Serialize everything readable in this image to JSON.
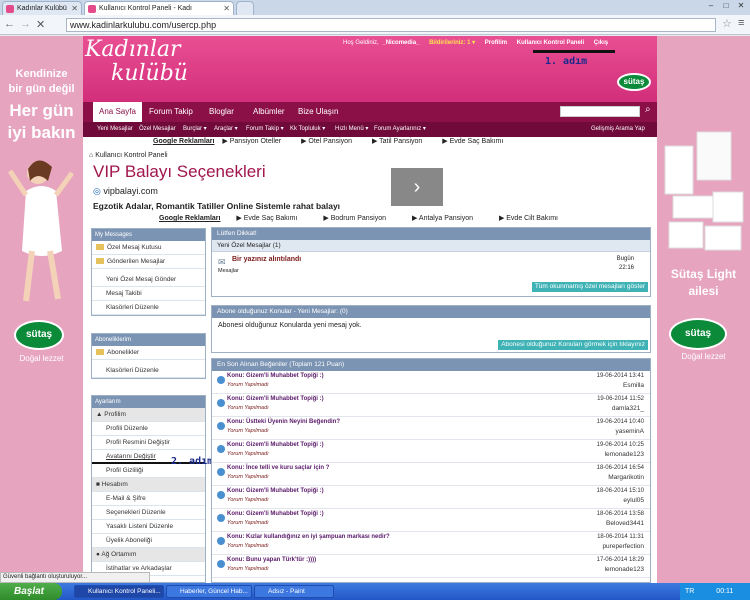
{
  "browser": {
    "tabs": [
      {
        "label": "Kadınlar Kulübü"
      },
      {
        "label": "Kullanıcı Kontrol Paneli - Kadı"
      }
    ],
    "url": "www.kadinlarkulubu.com/usercp.php"
  },
  "header": {
    "logo_line1": "Kadınlar",
    "logo_line2": "kulübü",
    "greeting": "Hoş Geldiniz,",
    "username": "_Nicomedia_",
    "notifications": "Bildirileriniz: 1 ▾",
    "profile_link": "Profilim",
    "cp_link": "Kullanıcı Kontrol Paneli",
    "logout": "Çıkış",
    "brand_badge": "sütaş",
    "annotation1": "1. adım"
  },
  "nav": {
    "items": [
      "Ana Sayfa",
      "Forum Takip",
      "Bloglar",
      "Albümler",
      "Bize Ulaşın"
    ],
    "search_placeholder": ""
  },
  "subnav": {
    "items": [
      "Yeni Mesajlar",
      "Özel Mesajlar",
      "Burçlar ▾",
      "Araçlar ▾",
      "Forum Takip ▾",
      "Kk Topluluk ▾",
      "Hızlı Menü ▾",
      "Forum Ayarlarınız ▾"
    ],
    "advanced_search": "Gelişmiş Arama Yap"
  },
  "google_ads_1": {
    "label": "Google Reklamları",
    "links": [
      "▶ Pansiyon Oteller",
      "▶ Otel Pansiyon",
      "▶ Tatil Pansiyon",
      "▶ Evde Saç Bakımı"
    ]
  },
  "breadcrumb": "Kullanıcı Kontrol Paneli",
  "vip_ad": {
    "title": "VIP Balayı Seçenekleri",
    "url": "vipbalayi.com",
    "desc": "Egzotik Adalar, Romantik Tatiller Online Sistemle rahat balayı",
    "arrow": "›"
  },
  "google_ads_2": {
    "label": "Google Reklamları",
    "links": [
      "▶ Evde Saç Bakımı",
      "▶ Bodrum Pansiyon",
      "▶ Antalya Pansiyon",
      "▶ Evde Cilt Bakımı"
    ]
  },
  "sidebar": {
    "my_messages": {
      "title": "My Messages",
      "items": [
        "Özel Mesaj Kutusu",
        "Gönderilen Mesajlar",
        "Yeni Özel Mesaj Gönder",
        "Mesaj Takibi",
        "Klasörleri Düzenle"
      ]
    },
    "subscriptions": {
      "title": "Aboneliklerim",
      "items": [
        "Abonelikler",
        "Klasörleri Düzenle"
      ]
    },
    "settings": {
      "title": "Ayarlarım",
      "profile_header": "Profilim",
      "profile_items": [
        "Profili Düzenle",
        "Profil Resmini Değiştir",
        "Avatarını Değiştir",
        "Profil Gizliliği"
      ],
      "account_header": "Hesabım",
      "account_items": [
        "E-Mail & Şifre",
        "Seçenekleri Düzenle",
        "Yasaklı Listeni Düzenle",
        "Üyelik Aboneliği"
      ],
      "network_header": "Ağ Ortamım",
      "network_items": [
        "İstihatlar ve Arkadaşlar"
      ]
    },
    "annotation2": "2. adım"
  },
  "attention_panel": {
    "title": "Lütfen Dikkat!",
    "sub": "Yeni Özel Mesajlar (1)",
    "msg_title": "Bir yazınız alıntılandı",
    "msg_from": "Mesajlar",
    "msg_day": "Bugün",
    "msg_time": "22:16",
    "button": "Tüm okunmamış özel mesajları göster"
  },
  "subscribed_panel": {
    "title": "Abone olduğunuz Konular - Yeni Mesajlar: (0)",
    "text": "Abonesi olduğunuz Konularda yeni mesaj yok.",
    "button": "Abonesi olduğunuz Konuları görmek için tıklayınız"
  },
  "likes_panel": {
    "title": "En Son Alınan Beğeniler (Toplam 121 Puan)",
    "rows": [
      {
        "title": "Konu: Gizem'li Muhabbet Topiği :)",
        "sub": "Yorum Yapılmadı",
        "date": "19-06-2014 13:41",
        "user": "Esmilla"
      },
      {
        "title": "Konu: Gizem'li Muhabbet Topiği :)",
        "sub": "Yorum Yapılmadı",
        "date": "19-06-2014 11:52",
        "user": "damla321_"
      },
      {
        "title": "Konu: Üstteki Üyenin Neyini Beğendin?",
        "sub": "Yorum Yapılmadı",
        "date": "19-06-2014 10:40",
        "user": "yaseminA"
      },
      {
        "title": "Konu: Gizem'li Muhabbet Topiği :)",
        "sub": "Yorum Yapılmadı",
        "date": "19-06-2014 10:25",
        "user": "lemonade123"
      },
      {
        "title": "Konu: İnce telli ve kuru saçlar için ?",
        "sub": "Yorum Yapılmadı",
        "date": "18-06-2014 16:54",
        "user": "Margarikotin"
      },
      {
        "title": "Konu: Gizem'li Muhabbet Topiği :)",
        "sub": "Yorum Yapılmadı",
        "date": "18-06-2014 15:10",
        "user": "eylul05"
      },
      {
        "title": "Konu: Gizem'li Muhabbet Topiği :)",
        "sub": "Yorum Yapılmadı",
        "date": "18-06-2014 13:58",
        "user": "Beloved3441"
      },
      {
        "title": "Konu: Kızlar kullandığınız en iyi şampuan markası nedir?",
        "sub": "Yorum Yapılmadı",
        "date": "18-06-2014 11:31",
        "user": "pureperfection"
      },
      {
        "title": "Konu: Bunu yapan Türk'tür :))))",
        "sub": "Yorum Yapılmadı",
        "date": "17-06-2014 18:29",
        "user": "lemonade123"
      }
    ]
  },
  "left_ad": {
    "line1": "Kendinize",
    "line2": "bir gün değil",
    "line3": "Her gün",
    "line4": "iyi bakın",
    "brand": "sütaş",
    "tagline": "Doğal lezzet"
  },
  "right_ad": {
    "line1": "Sütaş Light",
    "line2": "ailesi",
    "brand": "sütaş",
    "tagline": "Doğal lezzet"
  },
  "status_bar": "Güvenli bağlantı oluşturuluyor...",
  "taskbar": {
    "start": "Başlat",
    "buttons": [
      "Kullanıcı Kontrol Paneli...",
      "Haberler, Güncel Hab...",
      "Adsız - Paint"
    ],
    "lang": "TR",
    "time": "00:11"
  }
}
